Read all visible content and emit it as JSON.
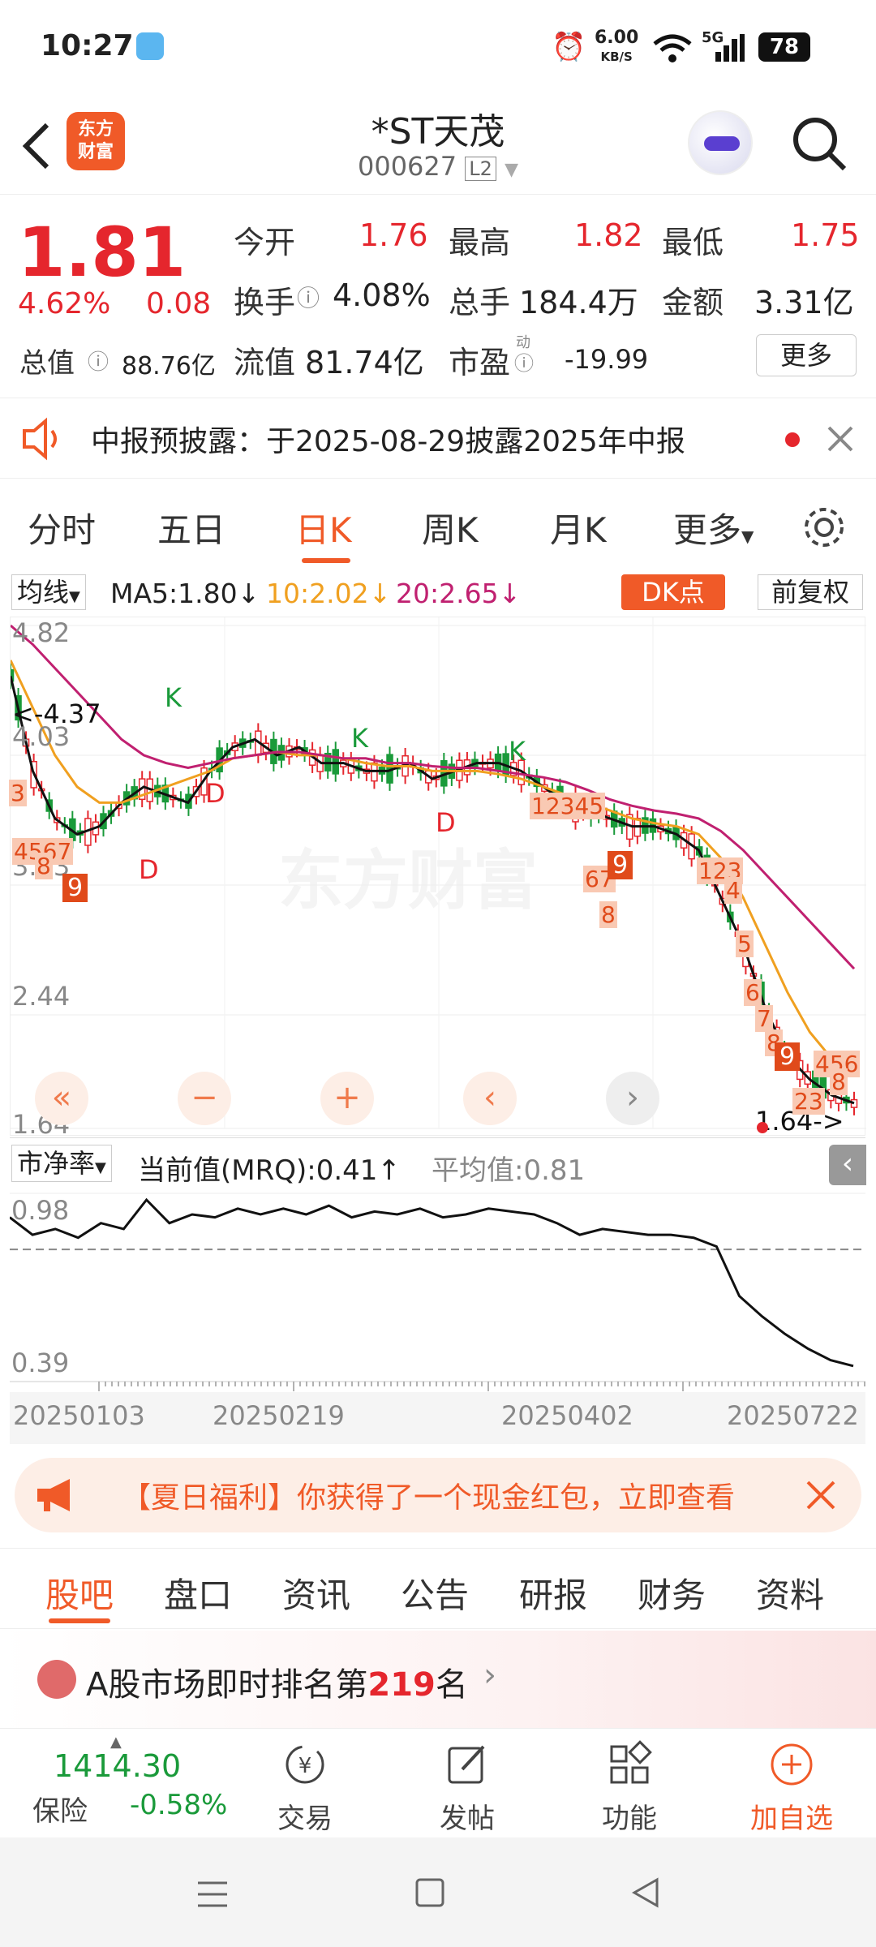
{
  "status": {
    "time": "10:27",
    "speed_value": "6.00",
    "speed_unit": "KB/S",
    "network": "5G",
    "battery": "78"
  },
  "header": {
    "stock_name": "*ST天茂",
    "stock_code": "000627",
    "level": "L2",
    "logo_text_1": "东方",
    "logo_text_2": "财富"
  },
  "quote": {
    "price": "1.81",
    "change_pct": "4.62%",
    "change": "0.08",
    "open_label": "今开",
    "open": "1.76",
    "high_label": "最高",
    "high": "1.82",
    "low_label": "最低",
    "low": "1.75",
    "turnover_label": "换手",
    "turnover": "4.08%",
    "volume_label": "总手",
    "volume": "184.4万",
    "amount_label": "金额",
    "amount": "3.31亿",
    "mktcap_label": "总值",
    "mktcap": "88.76亿",
    "float_label": "流值",
    "float_cap": "81.74亿",
    "pe_label": "市盈",
    "pe_sup": "动",
    "pe": "-19.99",
    "more": "更多"
  },
  "notice": {
    "text": "中报预披露：于2025-08-29披露2025年中报"
  },
  "period_tabs": [
    "分时",
    "五日",
    "日K",
    "周K",
    "月K",
    "更多"
  ],
  "active_tab": "日K",
  "chart_toolbar": {
    "indicator": "均线",
    "ma5": "MA5:1.80",
    "ma10": "10:2.02",
    "ma20": "20:2.65",
    "dk": "DK点",
    "adjust": "前复权"
  },
  "chart_data": {
    "type": "line",
    "y_ticks": [
      "4.82",
      "4.03",
      "3.23",
      "2.44",
      "1.64"
    ],
    "ylim": [
      1.64,
      4.82
    ],
    "annotations": [
      "<-4.37",
      "1.64->"
    ],
    "series": [
      {
        "name": "MA5",
        "color": "#111111",
        "values": [
          4.5,
          3.9,
          3.6,
          3.5,
          3.55,
          3.7,
          3.8,
          3.75,
          3.7,
          3.9,
          4.05,
          4.1,
          4.0,
          4.05,
          3.95,
          3.95,
          3.9,
          3.9,
          3.95,
          3.85,
          3.9,
          3.95,
          3.95,
          3.9,
          3.8,
          3.7,
          3.65,
          3.6,
          3.55,
          3.55,
          3.5,
          3.4,
          3.1,
          2.8,
          2.4,
          2.1,
          1.95,
          1.85,
          1.8
        ]
      },
      {
        "name": "MA10",
        "color": "#f0a020",
        "values": [
          4.6,
          4.3,
          4.0,
          3.8,
          3.7,
          3.7,
          3.75,
          3.8,
          3.85,
          3.9,
          3.98,
          4.0,
          4.02,
          4.0,
          4.0,
          3.98,
          3.95,
          3.93,
          3.93,
          3.9,
          3.9,
          3.9,
          3.88,
          3.85,
          3.8,
          3.75,
          3.7,
          3.65,
          3.6,
          3.57,
          3.55,
          3.5,
          3.35,
          3.1,
          2.8,
          2.5,
          2.25,
          2.08,
          2.02
        ]
      },
      {
        "name": "MA20",
        "color": "#c02070",
        "values": [
          4.82,
          4.7,
          4.55,
          4.4,
          4.25,
          4.1,
          4.0,
          3.95,
          3.92,
          3.95,
          3.98,
          4.0,
          4.02,
          4.02,
          4.0,
          3.98,
          3.98,
          3.95,
          3.95,
          3.93,
          3.92,
          3.92,
          3.9,
          3.88,
          3.86,
          3.83,
          3.78,
          3.72,
          3.68,
          3.65,
          3.63,
          3.6,
          3.52,
          3.4,
          3.25,
          3.1,
          2.95,
          2.8,
          2.65
        ]
      }
    ]
  },
  "chart_controls": {
    "fast_back": "«",
    "zoom_out": "−",
    "zoom_in": "+",
    "prev": "‹",
    "next": "›"
  },
  "watermark": "东方财富",
  "pb": {
    "indicator": "市净率",
    "current": "当前值(MRQ):0.41",
    "avg": "平均值:0.81",
    "y_ticks": [
      "0.98",
      "0.39"
    ],
    "values": [
      0.92,
      0.86,
      0.88,
      0.85,
      0.9,
      0.88,
      0.98,
      0.9,
      0.93,
      0.92,
      0.95,
      0.93,
      0.95,
      0.93,
      0.96,
      0.92,
      0.94,
      0.93,
      0.95,
      0.92,
      0.93,
      0.95,
      0.94,
      0.93,
      0.9,
      0.86,
      0.88,
      0.87,
      0.86,
      0.86,
      0.85,
      0.82,
      0.65,
      0.58,
      0.52,
      0.47,
      0.43,
      0.41
    ],
    "dates": [
      "20250103",
      "20250219",
      "20250402",
      "20250722"
    ]
  },
  "banner": {
    "text": "【夏日福利】你获得了一个现金红包，立即查看"
  },
  "bottom_tabs": [
    "股吧",
    "盘口",
    "资讯",
    "公告",
    "研报",
    "财务",
    "资料"
  ],
  "active_bottom_tab": "股吧",
  "rank": {
    "prefix": "A股市场即时排名第",
    "rank": "219",
    "suffix": "名"
  },
  "toolbar": {
    "index_value": "1414.30",
    "index_name": "保险",
    "index_change": "-0.58%",
    "trade": "交易",
    "post": "发帖",
    "func": "功能",
    "watch": "加自选"
  },
  "colors": {
    "up": "#e5262d",
    "down": "#1a9a3a",
    "accent": "#f05a28"
  }
}
